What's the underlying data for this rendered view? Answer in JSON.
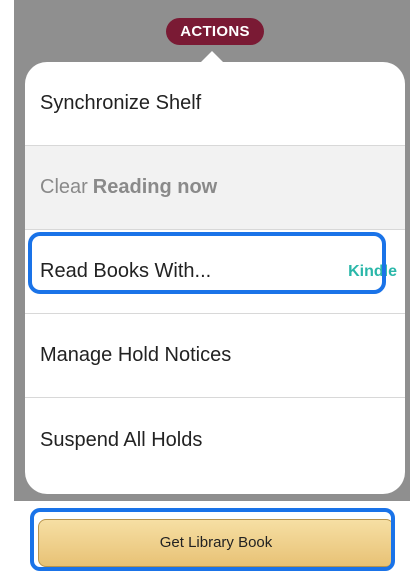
{
  "header": {
    "actions_label": "ACTIONS"
  },
  "menu": {
    "items": [
      {
        "label": "Synchronize Shelf"
      },
      {
        "label": "Clear",
        "bold": "Reading now"
      },
      {
        "label": "Read Books With...",
        "value": "Kindle"
      },
      {
        "label": "Manage Hold Notices"
      },
      {
        "label": "Suspend All Holds"
      }
    ]
  },
  "footer": {
    "button_label": "Get Library Book"
  },
  "colors": {
    "accent": "#7a1a34",
    "highlight": "#1a73e8",
    "kindle": "#2ab7a9"
  }
}
